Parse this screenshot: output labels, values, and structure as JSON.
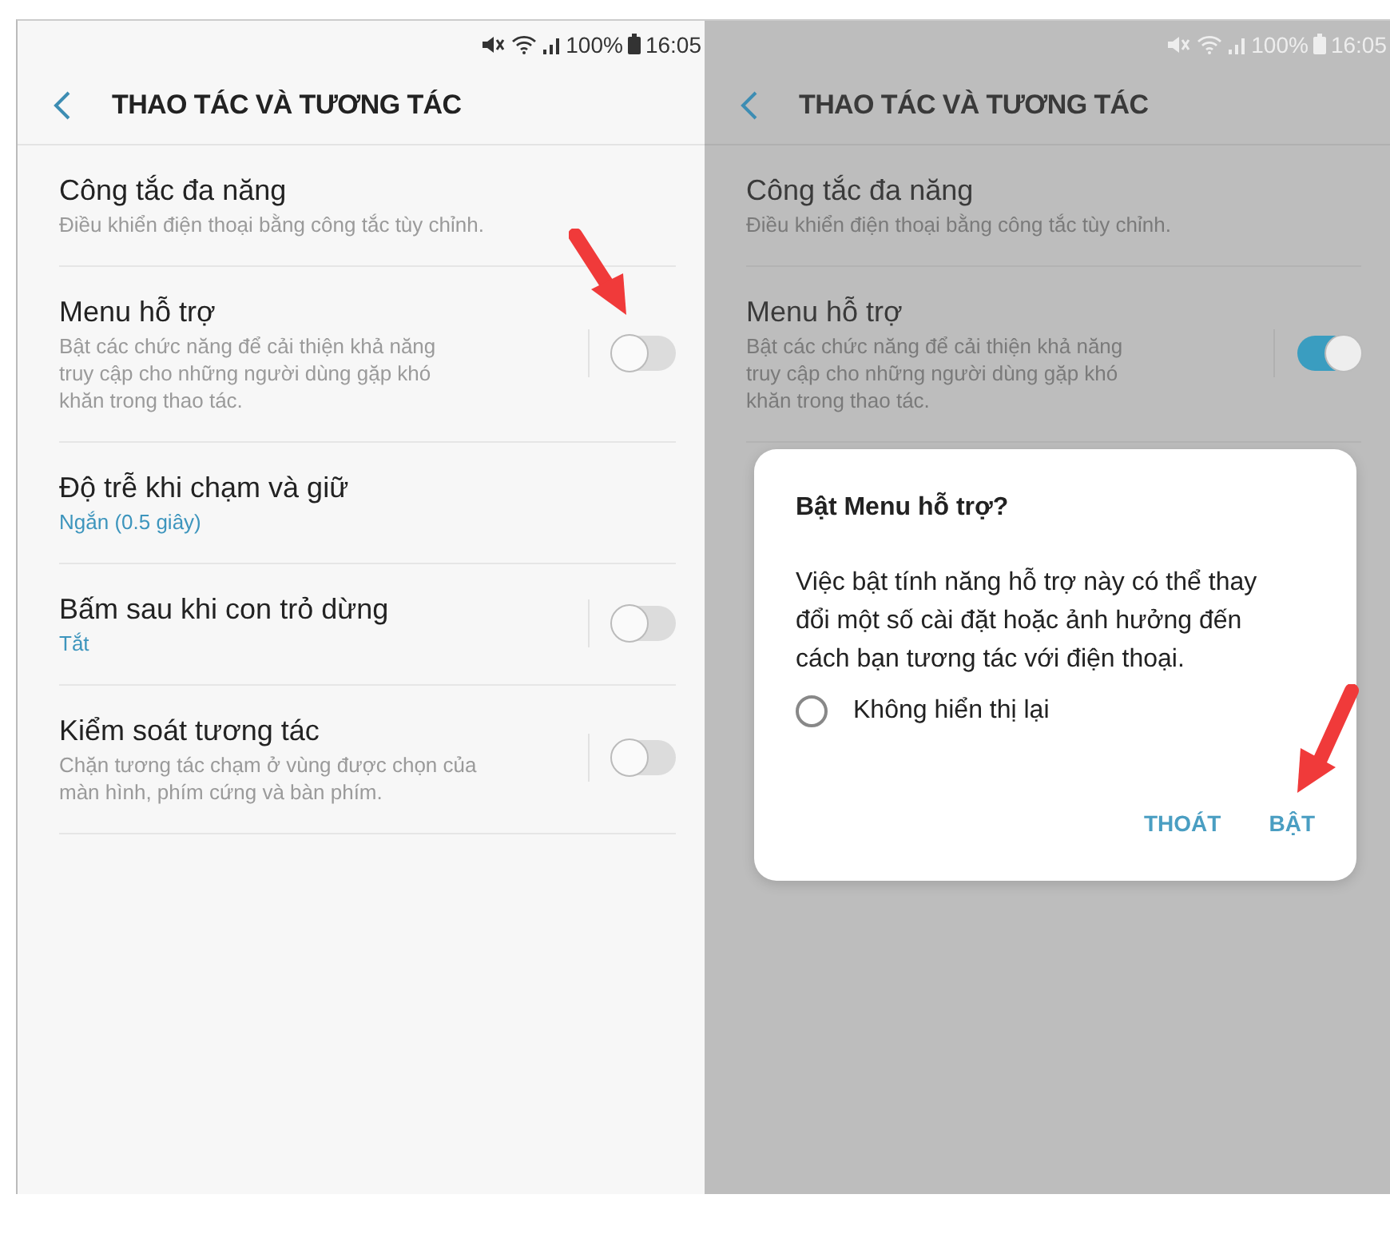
{
  "screens": [
    {
      "dimmed": false,
      "status_bar": {
        "battery": "100%",
        "time": "16:05"
      },
      "title": "THAO TÁC VÀ TƯƠNG TÁC",
      "rows": [
        {
          "kind": "plain",
          "title": "Công tắc đa năng",
          "description_highlighted": false,
          "description_lines": [
            "Điều khiển điện thoại bằng công tắc tùy chỉnh."
          ]
        },
        {
          "kind": "toggle",
          "on": false,
          "title": "Menu hỗ trợ",
          "description_highlighted": false,
          "description_lines": [
            "Bật các chức năng để cải thiện khả năng",
            "truy cập cho những người dùng gặp khó",
            "khăn trong thao tác."
          ]
        },
        {
          "kind": "plain",
          "title": "Độ trễ khi chạm và giữ",
          "description_highlighted": true,
          "description_lines": [
            "Ngắn (0.5 giây)"
          ]
        },
        {
          "kind": "toggle",
          "on": false,
          "title": "Bấm sau khi con trỏ dừng",
          "description_highlighted": true,
          "description_lines": [
            "Tắt"
          ]
        },
        {
          "kind": "toggle",
          "on": false,
          "title": "Kiểm soát tương tác",
          "description_highlighted": false,
          "description_lines": [
            "Chặn tương tác chạm ở vùng được chọn của",
            "màn hình, phím cứng và bàn phím."
          ]
        }
      ]
    },
    {
      "dimmed": true,
      "status_bar": {
        "battery": "100%",
        "time": "16:05"
      },
      "title": "THAO TÁC VÀ TƯƠNG TÁC",
      "rows": [
        {
          "kind": "plain",
          "title": "Công tắc đa năng",
          "description_highlighted": false,
          "description_lines": [
            "Điều khiển điện thoại bằng công tắc tùy chỉnh."
          ]
        },
        {
          "kind": "toggle",
          "on": true,
          "title": "Menu hỗ trợ",
          "description_highlighted": false,
          "description_lines": [
            "Bật các chức năng để cải thiện khả năng",
            "truy cập cho những người dùng gặp khó",
            "khăn trong thao tác."
          ]
        }
      ],
      "dialog": {
        "title": "Bật Menu hỗ trợ?",
        "message": "Việc bật tính năng hỗ trợ này có thể thay đổi một số cài đặt hoặc ảnh hưởng đến cách bạn tương tác với điện thoại.",
        "checkbox": {
          "label": "Không hiển thị lại",
          "checked": false
        },
        "buttons": [
          "THOÁT",
          "BẬT"
        ]
      }
    }
  ]
}
